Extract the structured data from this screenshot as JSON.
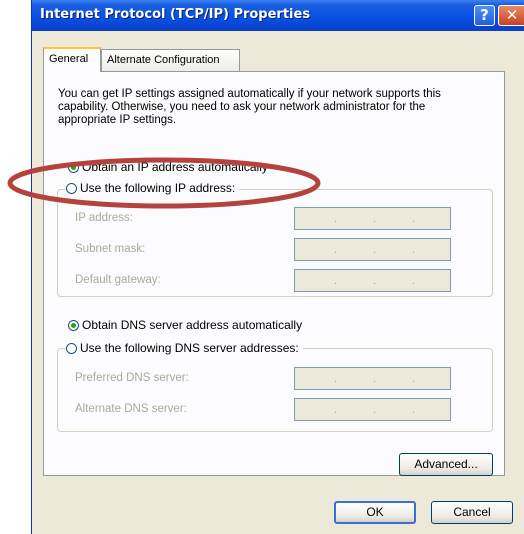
{
  "window": {
    "title": "Internet Protocol (TCP/IP) Properties",
    "help_glyph": "?",
    "close_glyph": "✕"
  },
  "tabs": [
    {
      "label": "General"
    },
    {
      "label": "Alternate Configuration"
    }
  ],
  "description": "You can get IP settings assigned automatically if your network supports this capability. Otherwise, you need to ask your network administrator for the appropriate IP settings.",
  "ip": {
    "auto_label": "Obtain an IP address automatically",
    "manual_label": "Use the following IP address:",
    "selected": "auto",
    "fields": [
      {
        "label": "IP address:"
      },
      {
        "label": "Subnet mask:"
      },
      {
        "label": "Default gateway:"
      }
    ]
  },
  "dns": {
    "auto_label": "Obtain DNS server address automatically",
    "manual_label": "Use the following DNS server addresses:",
    "selected": "auto",
    "fields": [
      {
        "label": "Preferred DNS server:"
      },
      {
        "label": "Alternate DNS server:"
      }
    ]
  },
  "buttons": {
    "advanced": "Advanced...",
    "ok": "OK",
    "cancel": "Cancel"
  },
  "ip_dot": ".",
  "colors": {
    "annotation_ellipse": "#b5423c",
    "titlebar": "#0a54e3",
    "dialog_bg": "#ece9d8"
  }
}
